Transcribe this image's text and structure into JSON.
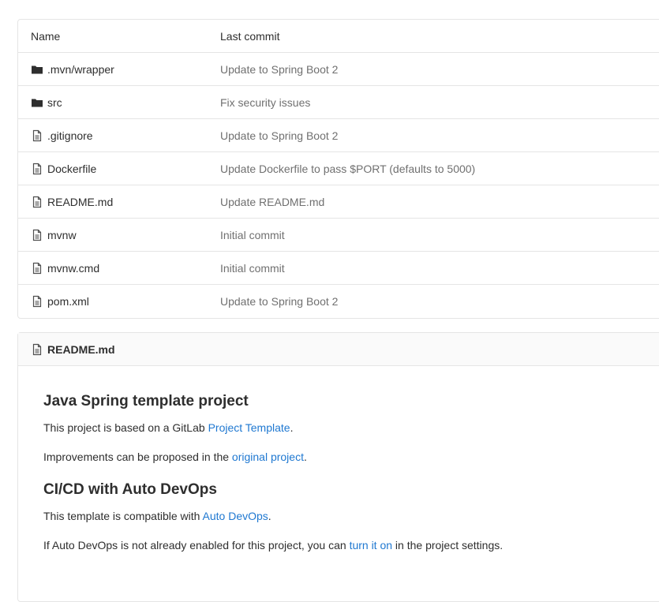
{
  "tree": {
    "headers": {
      "name": "Name",
      "last_commit": "Last commit"
    },
    "rows": [
      {
        "type": "folder",
        "name": ".mvn/wrapper",
        "commit": "Update to Spring Boot 2"
      },
      {
        "type": "folder",
        "name": "src",
        "commit": "Fix security issues"
      },
      {
        "type": "file",
        "name": ".gitignore",
        "commit": "Update to Spring Boot 2"
      },
      {
        "type": "file",
        "name": "Dockerfile",
        "commit": "Update Dockerfile to pass $PORT (defaults to 5000)"
      },
      {
        "type": "file",
        "name": "README.md",
        "commit": "Update README.md"
      },
      {
        "type": "file",
        "name": "mvnw",
        "commit": "Initial commit"
      },
      {
        "type": "file",
        "name": "mvnw.cmd",
        "commit": "Initial commit"
      },
      {
        "type": "file",
        "name": "pom.xml",
        "commit": "Update to Spring Boot 2"
      }
    ]
  },
  "readme": {
    "title": "README.md",
    "h1": "Java Spring template project",
    "p1_before": "This project is based on a GitLab ",
    "p1_link": "Project Template",
    "p1_after": ".",
    "p2_before": "Improvements can be proposed in the ",
    "p2_link": "original project",
    "p2_after": ".",
    "h2": "CI/CD with Auto DevOps",
    "p3_before": "This template is compatible with ",
    "p3_link": "Auto DevOps",
    "p3_after": ".",
    "p4_before": "If Auto DevOps is not already enabled for this project, you can ",
    "p4_link": "turn it on",
    "p4_after": " in the project settings."
  },
  "colors": {
    "link": "#1f78d1",
    "muted": "#707070",
    "border": "#e5e5e5"
  }
}
